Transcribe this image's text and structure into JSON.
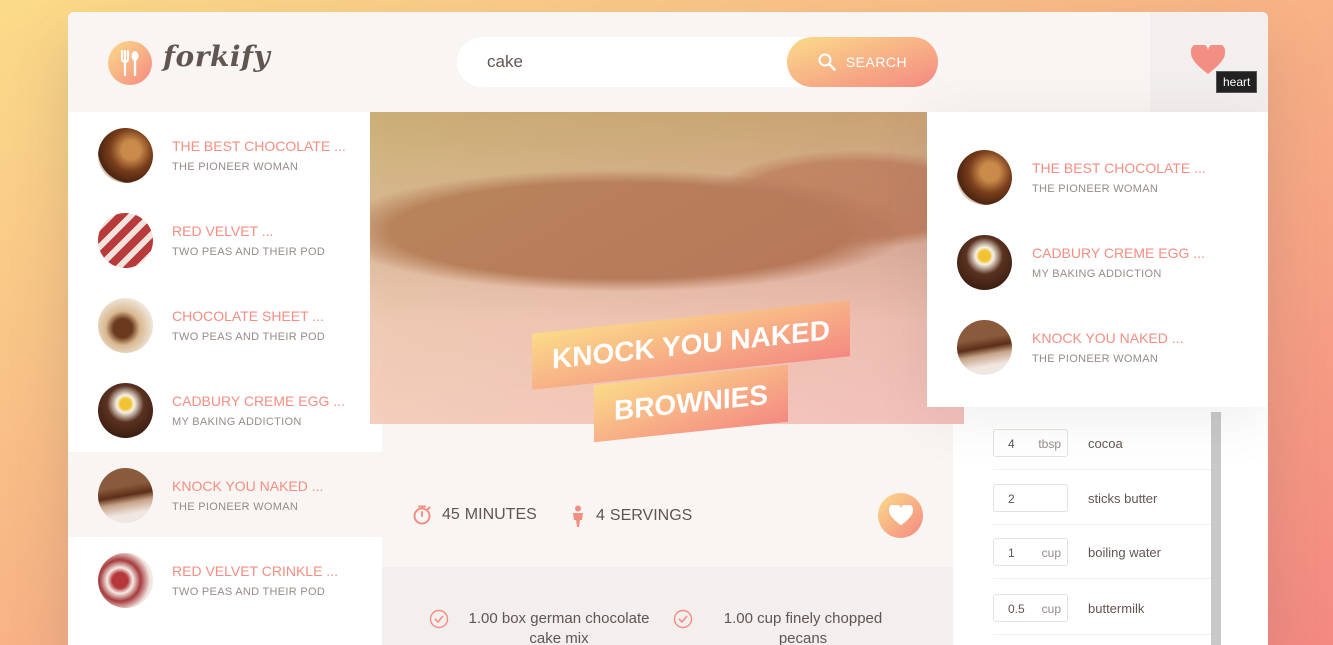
{
  "brand": {
    "name": "forkify"
  },
  "search": {
    "value": "cake",
    "button_label": "SEARCH"
  },
  "likes": {
    "tooltip": "heart"
  },
  "results": [
    {
      "title": "THE BEST CHOCOLATE ...",
      "author": "THE PIONEER WOMAN",
      "active": false
    },
    {
      "title": "RED VELVET ...",
      "author": "TWO PEAS AND THEIR POD",
      "active": false
    },
    {
      "title": "CHOCOLATE SHEET ...",
      "author": "TWO PEAS AND THEIR POD",
      "active": false
    },
    {
      "title": "CADBURY CREME EGG ...",
      "author": "MY BAKING ADDICTION",
      "active": false
    },
    {
      "title": "KNOCK YOU NAKED ...",
      "author": "THE PIONEER WOMAN",
      "active": true
    },
    {
      "title": "RED VELVET CRINKLE ...",
      "author": "TWO PEAS AND THEIR POD",
      "active": false
    }
  ],
  "liked_recipes": [
    {
      "title": "THE BEST CHOCOLATE ...",
      "author": "THE PIONEER WOMAN"
    },
    {
      "title": "CADBURY CREME EGG ...",
      "author": "MY BAKING ADDICTION"
    },
    {
      "title": "KNOCK YOU NAKED ...",
      "author": "THE PIONEER WOMAN"
    }
  ],
  "recipe": {
    "title_line1": "KNOCK YOU NAKED",
    "title_line2": "BROWNIES",
    "minutes": "45",
    "minutes_label": "MINUTES",
    "servings": "4",
    "servings_label": "SERVINGS",
    "ingredients": [
      "1.00 box german chocolate cake mix",
      "1.00 cup finely chopped pecans"
    ]
  },
  "shopping_list": [
    {
      "count": "4",
      "unit": "tbsp",
      "description": "cocoa"
    },
    {
      "count": "2",
      "unit": "",
      "description": "sticks butter"
    },
    {
      "count": "1",
      "unit": "cup",
      "description": "boiling water"
    },
    {
      "count": "0.5",
      "unit": "cup",
      "description": "buttermilk"
    }
  ],
  "colors": {
    "accent": "#f38e82",
    "gradient_start": "#fbdb89",
    "gradient_end": "#f48982"
  }
}
